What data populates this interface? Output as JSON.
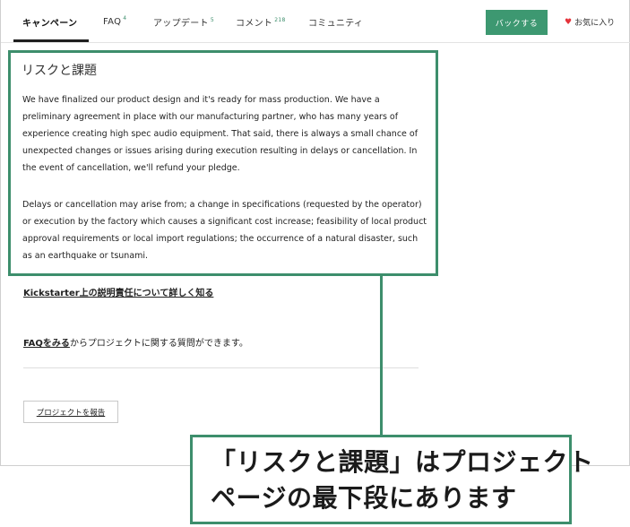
{
  "nav": {
    "tabs": [
      {
        "label": "キャンペーン",
        "count": ""
      },
      {
        "label": "FAQ",
        "count": "4"
      },
      {
        "label": "アップデート",
        "count": "5"
      },
      {
        "label": "コメント",
        "count": "218"
      },
      {
        "label": "コミュニティ",
        "count": ""
      }
    ],
    "back_label": "バックする",
    "favorite_label": "お気に入り"
  },
  "risk": {
    "title": "リスクと課題",
    "paragraphs": [
      "We have finalized our product design and it's ready for mass production. We have a preliminary agreement in place with our manufacturing partner, who has many years of experience creating high spec audio equipment. That said, there is always a small chance of unexpected changes or issues arising during execution resulting in delays or cancellation. In the event of cancellation, we'll refund your pledge.",
      "Delays or cancellation may arise from; a change in specifications (requested by the operator) or execution by the factory which causes a significant cost increase; feasibility of local product approval requirements or local import regulations; the occurrence of a natural disaster, such as an earthquake or tsunami."
    ]
  },
  "links": {
    "accountability": "Kickstarter上の説明責任について詳しく知る",
    "faq_link": "FAQをみる",
    "faq_suffix": "からプロジェクトに関する質問ができます。",
    "report": "プロジェクトを報告"
  },
  "callout": {
    "line1": "「リスクと課題」はプロジェクト",
    "line2": "ページの最下段にあります"
  },
  "colors": {
    "accent": "#3d8e6c",
    "button": "#3d9871",
    "heart": "#e5333b"
  }
}
